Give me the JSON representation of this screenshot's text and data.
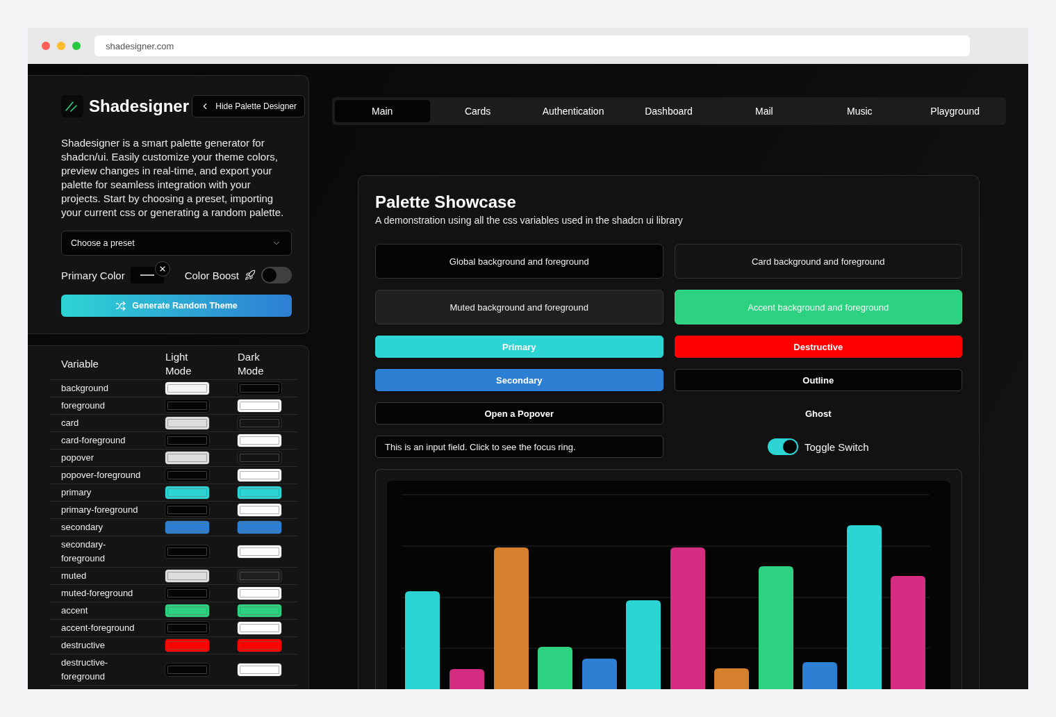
{
  "browser": {
    "url": "shadesigner.com"
  },
  "sidebar": {
    "brand": "Shadesigner",
    "hide_button": "Hide Palette Designer",
    "description": "Shadesigner is a smart palette generator for shadcn/ui. Easily customize your theme colors, preview changes in real-time, and export your palette for seamless integration with your projects. Start by choosing a preset, importing your current css or generating a random palette.",
    "preset_select": {
      "placeholder": "Choose a preset"
    },
    "primary_color": {
      "label": "Primary Color"
    },
    "color_boost": {
      "label": "Color Boost",
      "on": false
    },
    "generate_button": "Generate Random Theme"
  },
  "variables_table": {
    "columns": [
      "Variable",
      "Light Mode",
      "Dark Mode"
    ],
    "rows": [
      {
        "name": "background",
        "light": {
          "color": "#f5f5f5"
        },
        "dark": {
          "color": "#050505"
        }
      },
      {
        "name": "foreground",
        "light": {
          "color": "#050505"
        },
        "dark": {
          "color": "#ffffff"
        }
      },
      {
        "name": "card",
        "light": {
          "color": "#dcdcdc"
        },
        "dark": {
          "color": "#141414"
        }
      },
      {
        "name": "card-foreground",
        "light": {
          "color": "#050505"
        },
        "dark": {
          "color": "#ffffff"
        }
      },
      {
        "name": "popover",
        "light": {
          "color": "#dcdcdc"
        },
        "dark": {
          "color": "#141414"
        }
      },
      {
        "name": "popover-foreground",
        "light": {
          "color": "#050505"
        },
        "dark": {
          "color": "#ffffff"
        }
      },
      {
        "name": "primary",
        "light": {
          "color": "#2dd4d4"
        },
        "dark": {
          "color": "#2dd4d4"
        }
      },
      {
        "name": "primary-foreground",
        "light": {
          "color": "#050505"
        },
        "dark": {
          "color": "#ffffff"
        }
      },
      {
        "name": "secondary",
        "light": {
          "color": "#2d7fd4"
        },
        "dark": {
          "color": "#2d7fd4"
        }
      },
      {
        "name": "secondary-foreground",
        "light": {
          "color": "#050505"
        },
        "dark": {
          "color": "#ffffff"
        }
      },
      {
        "name": "muted",
        "light": {
          "color": "#dcdcdc"
        },
        "dark": {
          "color": "#1f1f1f"
        }
      },
      {
        "name": "muted-foreground",
        "light": {
          "color": "#050505"
        },
        "dark": {
          "color": "#ffffff"
        }
      },
      {
        "name": "accent",
        "light": {
          "color": "#2dd280"
        },
        "dark": {
          "color": "#2dd280"
        }
      },
      {
        "name": "accent-foreground",
        "light": {
          "color": "#050505"
        },
        "dark": {
          "color": "#ffffff"
        }
      },
      {
        "name": "destructive",
        "light": {
          "color": "#ff0000"
        },
        "dark": {
          "color": "#ff0000"
        }
      },
      {
        "name": "destructive-foreground",
        "light": {
          "color": "#050505"
        },
        "dark": {
          "color": "#ffffff"
        }
      }
    ]
  },
  "tabs": [
    {
      "label": "Main",
      "selected": true
    },
    {
      "label": "Cards",
      "selected": false
    },
    {
      "label": "Authentication",
      "selected": false
    },
    {
      "label": "Dashboard",
      "selected": false
    },
    {
      "label": "Mail",
      "selected": false
    },
    {
      "label": "Music",
      "selected": false
    },
    {
      "label": "Playground",
      "selected": false
    }
  ],
  "showcase": {
    "title": "Palette Showcase",
    "subtitle": "A demonstration using all the css variables used in the shadcn ui library",
    "samples": [
      {
        "kind": "global",
        "label": "Global background and foreground"
      },
      {
        "kind": "card",
        "label": "Card background and foreground"
      },
      {
        "kind": "muted",
        "label": "Muted background and foreground"
      },
      {
        "kind": "accent",
        "label": "Accent background and foreground"
      },
      {
        "kind": "primary",
        "label": "Primary"
      },
      {
        "kind": "destructive",
        "label": "Destructive"
      },
      {
        "kind": "secondary",
        "label": "Secondary"
      },
      {
        "kind": "outline",
        "label": "Outline"
      },
      {
        "kind": "popover",
        "label": "Open a Popover"
      },
      {
        "kind": "ghost",
        "label": "Ghost"
      },
      {
        "kind": "input",
        "placeholder": "This is an input field. Click to see the focus ring."
      },
      {
        "kind": "switch",
        "label": "Toggle Switch",
        "on": true
      }
    ]
  }
}
